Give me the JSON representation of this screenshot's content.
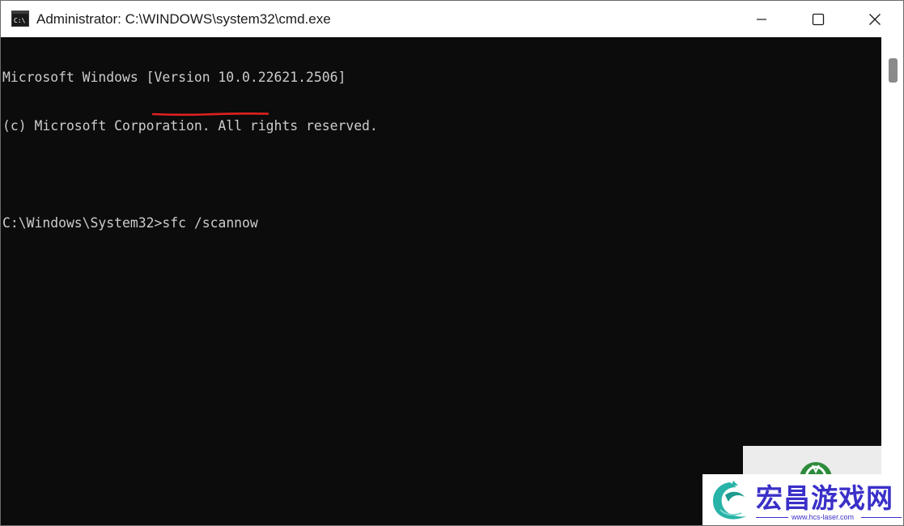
{
  "window": {
    "title": "Administrator: C:\\WINDOWS\\system32\\cmd.exe",
    "icon": "cmd-icon",
    "controls": {
      "minimize_icon": "minimize-icon",
      "maximize_icon": "maximize-icon",
      "close_icon": "close-icon"
    }
  },
  "console": {
    "lines": [
      "Microsoft Windows [Version 10.0.22621.2506]",
      "(c) Microsoft Corporation. All rights reserved.",
      ""
    ],
    "prompt": "C:\\Windows\\System32>",
    "command": "sfc /scannow",
    "highlight_color": "#e02020"
  },
  "colors": {
    "console_bg": "#0c0c0c",
    "console_text": "#cccccc",
    "titlebar_bg": "#ffffff"
  },
  "watermark": {
    "title": "宏昌游戏网",
    "url": "www.hcs-laser.com",
    "color": "#3a30c8"
  }
}
